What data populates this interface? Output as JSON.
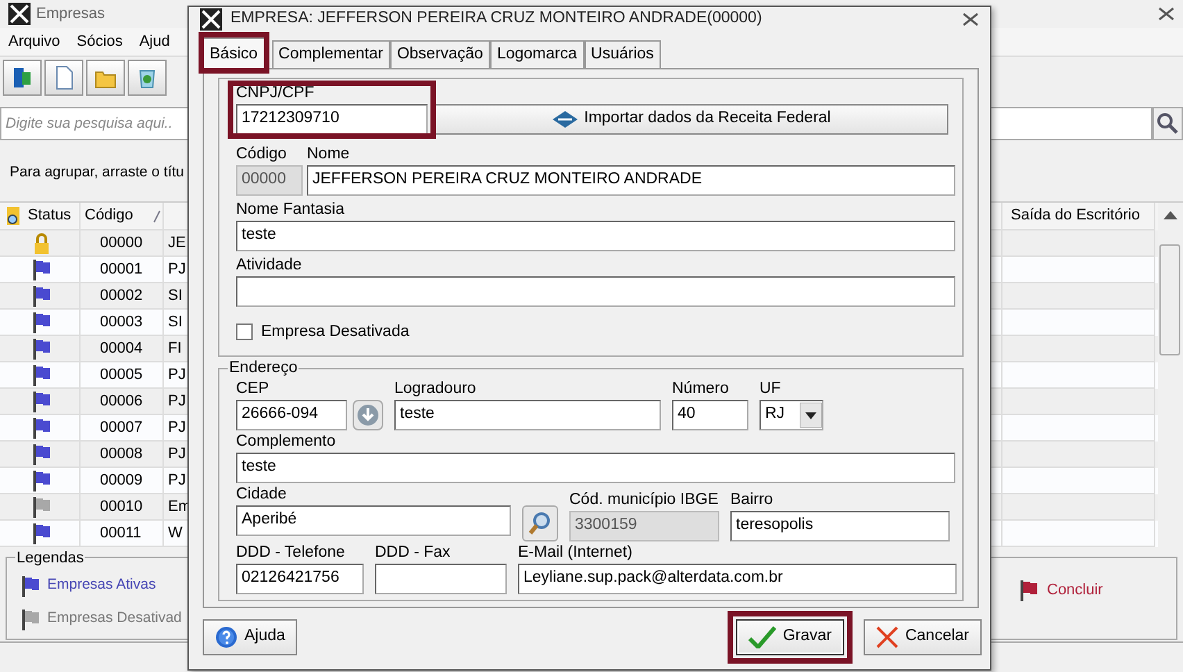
{
  "app": {
    "title": "Empresas",
    "menu": [
      "Arquivo",
      "Sócios",
      "Ajud"
    ],
    "search": {
      "placeholder": "Digite sua pesquisa aqui.."
    },
    "group_hint": "Para agrupar, arraste o títu",
    "columns": [
      "Status",
      "Código",
      "Saída do Escritório"
    ],
    "rows": [
      {
        "kind": "locked",
        "code": "00000",
        "name": "JE"
      },
      {
        "kind": "active",
        "code": "00001",
        "name": "PJ"
      },
      {
        "kind": "active",
        "code": "00002",
        "name": "SI"
      },
      {
        "kind": "active",
        "code": "00003",
        "name": "SI"
      },
      {
        "kind": "active",
        "code": "00004",
        "name": "FI"
      },
      {
        "kind": "active",
        "code": "00005",
        "name": "PJ"
      },
      {
        "kind": "active",
        "code": "00006",
        "name": "PJ"
      },
      {
        "kind": "active",
        "code": "00007",
        "name": "PJ"
      },
      {
        "kind": "active",
        "code": "00008",
        "name": "PJ"
      },
      {
        "kind": "active",
        "code": "00009",
        "name": "PJ"
      },
      {
        "kind": "inactive",
        "code": "00010",
        "name": "Em"
      },
      {
        "kind": "active",
        "code": "00011",
        "name": "W"
      }
    ],
    "legend": {
      "title": "Legendas",
      "items": [
        {
          "kind": "active",
          "label": "Empresas Ativas"
        },
        {
          "kind": "inactive",
          "label": "Empresas Desativad"
        }
      ],
      "done_button": "Concluir"
    }
  },
  "dialog": {
    "title": "EMPRESA: JEFFERSON PEREIRA CRUZ MONTEIRO ANDRADE(00000)",
    "tabs": [
      {
        "label": "Básico",
        "selected": true,
        "highlighted": true
      },
      {
        "label": "Complementar",
        "selected": false,
        "highlighted": false
      },
      {
        "label": "Observação",
        "selected": false,
        "highlighted": false
      },
      {
        "label": "Logomarca",
        "selected": false,
        "highlighted": false
      },
      {
        "label": "Usuários",
        "selected": false,
        "highlighted": false
      }
    ],
    "cnpj": {
      "label": "CNPJ/CPF",
      "value": "17212309710",
      "highlighted": true
    },
    "import_button": "Importar dados da Receita Federal",
    "basic_fields": [
      {
        "label": "Código",
        "value": "00000",
        "disabled": true
      },
      {
        "label": "Nome",
        "value": "JEFFERSON PEREIRA CRUZ MONTEIRO ANDRADE",
        "disabled": false
      },
      {
        "label": "Nome Fantasia",
        "value": "teste",
        "disabled": false
      },
      {
        "label": "Atividade",
        "disabled": false
      }
    ],
    "inactive_checkbox": {
      "label": "Empresa Desativada",
      "checked": false
    },
    "address": {
      "title": "Endereço",
      "fields": [
        {
          "kind": "lookup",
          "label": "CEP",
          "value": "26666-094",
          "disabled": false
        },
        {
          "kind": "text",
          "label": "Logradouro",
          "value": "teste",
          "disabled": false
        },
        {
          "kind": "text",
          "label": "Número",
          "value": "40",
          "disabled": false
        },
        {
          "kind": "select",
          "label": "UF",
          "value": "RJ",
          "disabled": false
        },
        {
          "kind": "text",
          "label": "Complemento",
          "value": "teste",
          "disabled": false
        },
        {
          "kind": "search",
          "label": "Cidade",
          "value": "Aperibé",
          "disabled": false
        },
        {
          "kind": "text",
          "label": "Cód. município IBGE",
          "value": "3300159",
          "disabled": true
        },
        {
          "kind": "text",
          "label": "Bairro",
          "value": "teresopolis",
          "disabled": false
        },
        {
          "kind": "text",
          "label": "DDD - Telefone",
          "value": "02126421756",
          "disabled": false
        },
        {
          "kind": "text",
          "label": "DDD - Fax",
          "disabled": false
        },
        {
          "kind": "text",
          "label": "E-Mail (Internet)",
          "value": "Leyliane.sup.pack@alterdata.com.br",
          "disabled": false
        }
      ]
    },
    "buttons": [
      {
        "kind": "help",
        "label": "Ajuda",
        "highlighted": false
      },
      {
        "kind": "save",
        "label": "Gravar",
        "highlighted": true
      },
      {
        "kind": "cancel",
        "label": "Cancelar",
        "highlighted": false
      }
    ]
  }
}
